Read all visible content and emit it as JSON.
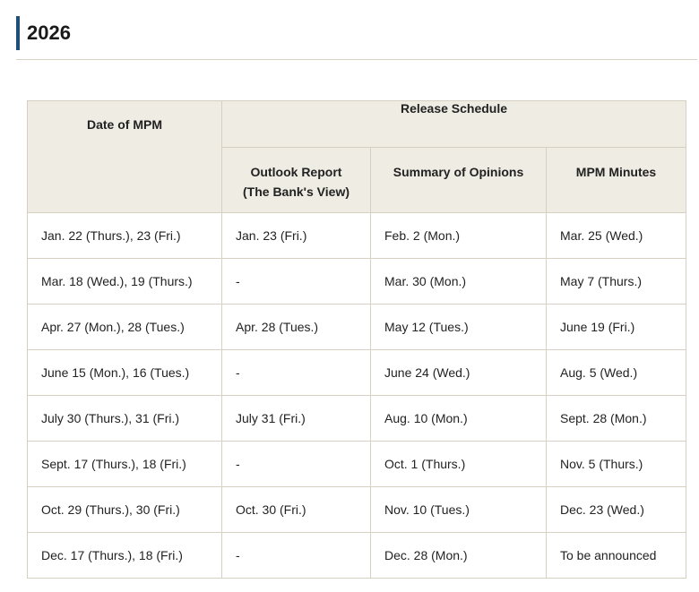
{
  "section": {
    "title": "2026"
  },
  "table": {
    "headers": {
      "date_of_mpm": "Date of MPM",
      "release_schedule": "Release Schedule",
      "outlook_report_line1": "Outlook Report",
      "outlook_report_line2": "(The Bank's View)",
      "summary_of_opinions": "Summary of Opinions",
      "mpm_minutes": "MPM Minutes"
    },
    "rows": [
      {
        "date": "Jan. 22 (Thurs.), 23 (Fri.)",
        "outlook": "Jan. 23 (Fri.)",
        "summary": "Feb. 2 (Mon.)",
        "minutes": "Mar. 25 (Wed.)"
      },
      {
        "date": "Mar. 18 (Wed.), 19 (Thurs.)",
        "outlook": "-",
        "summary": "Mar. 30 (Mon.)",
        "minutes": "May 7 (Thurs.)"
      },
      {
        "date": "Apr. 27 (Mon.), 28 (Tues.)",
        "outlook": "Apr. 28 (Tues.)",
        "summary": "May 12 (Tues.)",
        "minutes": "June 19 (Fri.)"
      },
      {
        "date": "June 15 (Mon.), 16 (Tues.)",
        "outlook": "-",
        "summary": "June 24 (Wed.)",
        "minutes": "Aug. 5 (Wed.)"
      },
      {
        "date": "July 30 (Thurs.), 31 (Fri.)",
        "outlook": "July 31 (Fri.)",
        "summary": "Aug. 10 (Mon.)",
        "minutes": "Sept. 28 (Mon.)"
      },
      {
        "date": "Sept. 17 (Thurs.), 18 (Fri.)",
        "outlook": "-",
        "summary": "Oct. 1 (Thurs.)",
        "minutes": "Nov. 5 (Thurs.)"
      },
      {
        "date": "Oct. 29 (Thurs.), 30 (Fri.)",
        "outlook": "Oct. 30 (Fri.)",
        "summary": "Nov. 10 (Tues.)",
        "minutes": "Dec. 23 (Wed.)"
      },
      {
        "date": "Dec. 17 (Thurs.), 18 (Fri.)",
        "outlook": "-",
        "summary": "Dec. 28 (Mon.)",
        "minutes": "To be announced"
      }
    ]
  },
  "colors": {
    "accent_bar": "#1f4e79",
    "header_bg": "#efece4",
    "border": "#d5d0c2"
  }
}
